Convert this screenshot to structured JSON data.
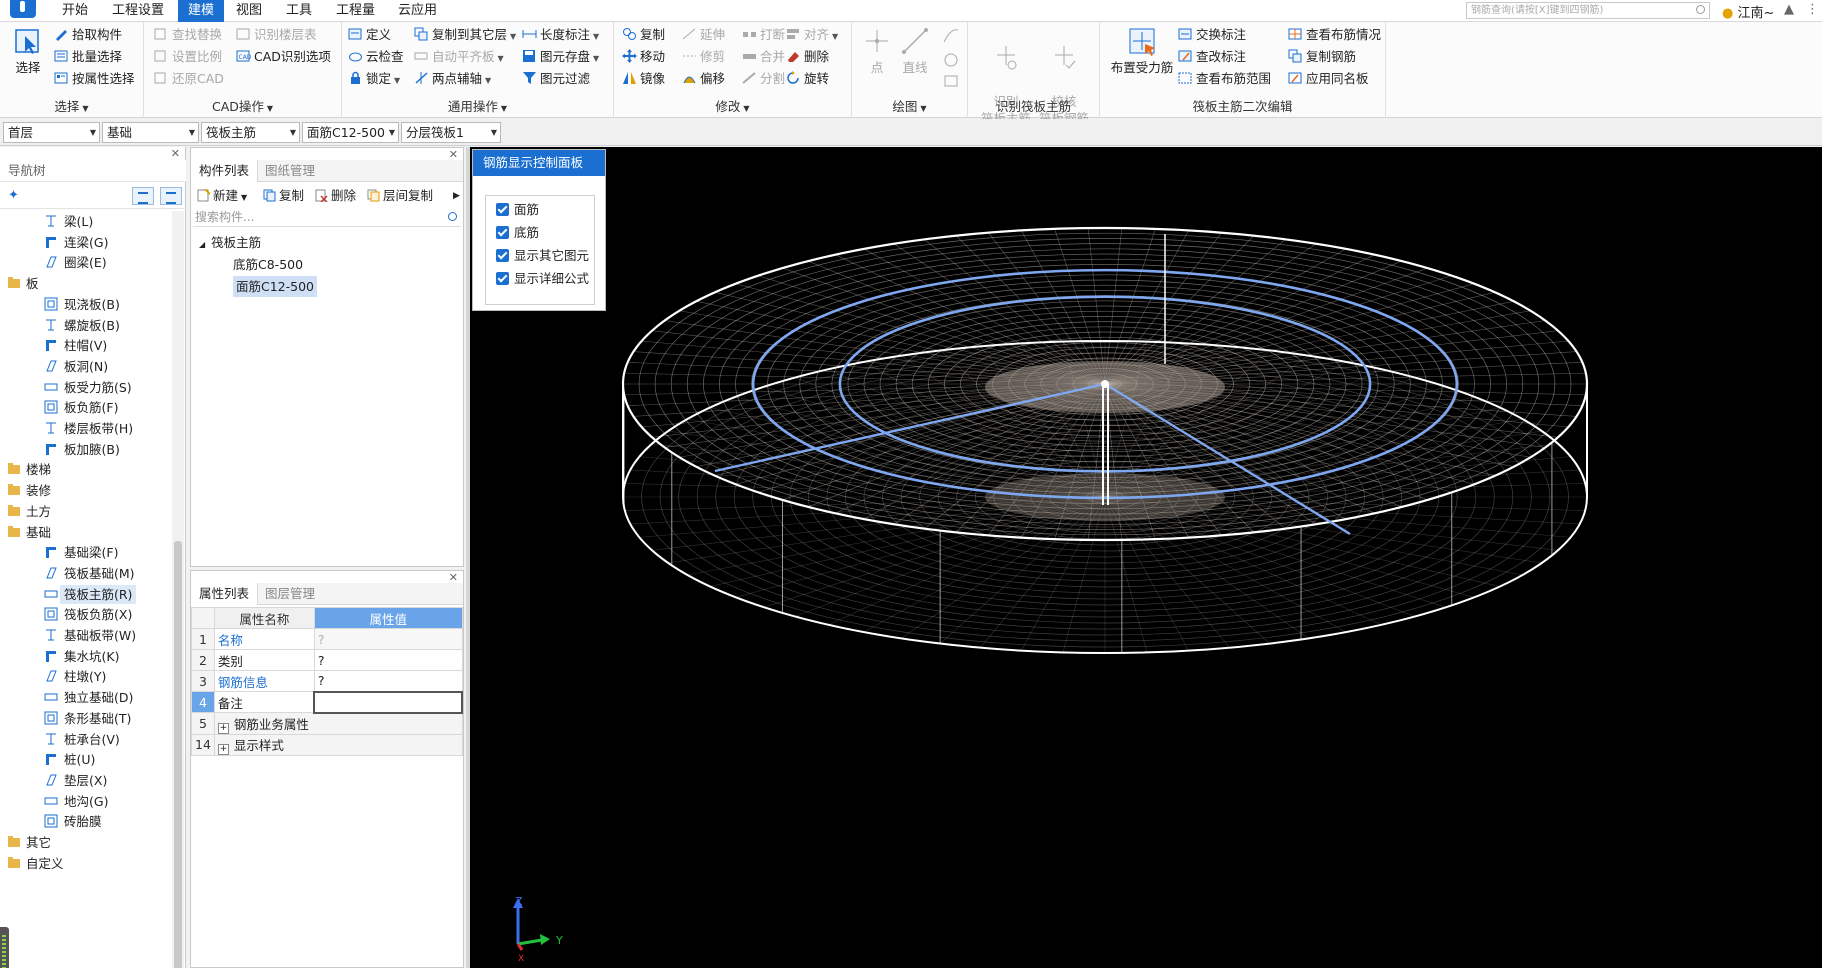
{
  "menubar": {
    "tabs": [
      "开始",
      "工程设置",
      "建模",
      "视图",
      "工具",
      "工程量",
      "云应用"
    ],
    "active_tab": "建模",
    "search_placeholder": "钢筋查询(请按[X]键到四钢筋)",
    "user": "江南~"
  },
  "ribbon": {
    "select_group": {
      "label": "选择",
      "big": "选择",
      "items": [
        "拾取构件",
        "批量选择",
        "按属性选择"
      ]
    },
    "cad_group": {
      "label": "CAD操作",
      "items": [
        "查找替换",
        "设置比例",
        "还原CAD",
        "识别楼层表",
        "CAD识别选项"
      ]
    },
    "general_group": {
      "label": "通用操作",
      "items": [
        "定义",
        "云检查",
        "锁定",
        "复制到其它层",
        "自动平齐板",
        "两点辅轴",
        "长度标注",
        "图元存盘",
        "图元过滤"
      ]
    },
    "modify_group": {
      "label": "修改",
      "items": [
        "复制",
        "移动",
        "镜像",
        "延伸",
        "修剪",
        "偏移",
        "打断",
        "合并",
        "分割",
        "对齐",
        "删除",
        "旋转"
      ]
    },
    "draw_group": {
      "label": "绘图",
      "items": [
        "点",
        "直线"
      ]
    },
    "identify_group": {
      "label": "识别筏板主筋",
      "items": [
        "识别\n筏板主筋",
        "校核\n筏板钢筋"
      ]
    },
    "edit_group": {
      "label": "筏板主筋二次编辑",
      "big": "布置受力筋",
      "items": [
        "交换标注",
        "查改标注",
        "查看布筋范围",
        "查看布筋情况",
        "复制钢筋",
        "应用同名板"
      ]
    }
  },
  "selectors": [
    "首层",
    "基础",
    "筏板主筋",
    "面筋C12-500",
    "分层筏板1"
  ],
  "nav": {
    "title": "导航树",
    "items": [
      {
        "type": "item",
        "label": "梁(L)",
        "icon": "beam-icon"
      },
      {
        "type": "item",
        "label": "连梁(G)",
        "icon": "coupling-beam-icon"
      },
      {
        "type": "item",
        "label": "圈梁(E)",
        "icon": "ring-beam-icon"
      },
      {
        "type": "cat",
        "label": "板"
      },
      {
        "type": "item",
        "label": "现浇板(B)",
        "icon": "slab-icon"
      },
      {
        "type": "item",
        "label": "螺旋板(B)",
        "icon": "spiral-slab-icon"
      },
      {
        "type": "item",
        "label": "柱帽(V)",
        "icon": "column-cap-icon"
      },
      {
        "type": "item",
        "label": "板洞(N)",
        "icon": "slab-hole-icon"
      },
      {
        "type": "item",
        "label": "板受力筋(S)",
        "icon": "slab-rebar-icon"
      },
      {
        "type": "item",
        "label": "板负筋(F)",
        "icon": "slab-neg-rebar-icon"
      },
      {
        "type": "item",
        "label": "楼层板带(H)",
        "icon": "slab-strip-icon"
      },
      {
        "type": "item",
        "label": "板加腋(B)",
        "icon": "slab-haunch-icon"
      },
      {
        "type": "cat",
        "label": "楼梯"
      },
      {
        "type": "cat",
        "label": "装修"
      },
      {
        "type": "cat",
        "label": "土方"
      },
      {
        "type": "cat",
        "label": "基础"
      },
      {
        "type": "item",
        "label": "基础梁(F)",
        "icon": "foundation-beam-icon"
      },
      {
        "type": "item",
        "label": "筏板基础(M)",
        "icon": "raft-foundation-icon"
      },
      {
        "type": "item",
        "label": "筏板主筋(R)",
        "icon": "raft-main-rebar-icon",
        "selected": true
      },
      {
        "type": "item",
        "label": "筏板负筋(X)",
        "icon": "raft-neg-rebar-icon"
      },
      {
        "type": "item",
        "label": "基础板带(W)",
        "icon": "foundation-strip-icon"
      },
      {
        "type": "item",
        "label": "集水坑(K)",
        "icon": "sump-icon"
      },
      {
        "type": "item",
        "label": "柱墩(Y)",
        "icon": "column-pier-icon"
      },
      {
        "type": "item",
        "label": "独立基础(D)",
        "icon": "isolated-footing-icon"
      },
      {
        "type": "item",
        "label": "条形基础(T)",
        "icon": "strip-footing-icon"
      },
      {
        "type": "item",
        "label": "桩承台(V)",
        "icon": "pile-cap-icon"
      },
      {
        "type": "item",
        "label": "桩(U)",
        "icon": "pile-icon"
      },
      {
        "type": "item",
        "label": "垫层(X)",
        "icon": "cushion-icon"
      },
      {
        "type": "item",
        "label": "地沟(G)",
        "icon": "trench-icon"
      },
      {
        "type": "item",
        "label": "砖胎膜",
        "icon": "brick-mold-icon"
      },
      {
        "type": "cat",
        "label": "其它"
      },
      {
        "type": "cat",
        "label": "自定义"
      }
    ]
  },
  "components": {
    "tabs": [
      "构件列表",
      "图纸管理"
    ],
    "toolbar": [
      "新建",
      "复制",
      "删除",
      "层间复制"
    ],
    "search_placeholder": "搜索构件...",
    "tree_root": "筏板主筋",
    "tree_items": [
      "底筋C8-500",
      "面筋C12-500"
    ],
    "selected": "面筋C12-500"
  },
  "properties": {
    "tabs": [
      "属性列表",
      "图层管理"
    ],
    "header_name": "属性名称",
    "header_value": "属性值",
    "rows": [
      {
        "num": "1",
        "name": "名称",
        "value": "?"
      },
      {
        "num": "2",
        "name": "类别",
        "value": "?"
      },
      {
        "num": "3",
        "name": "钢筋信息",
        "value": "?"
      },
      {
        "num": "4",
        "name": "备注",
        "value": ""
      },
      {
        "num": "5",
        "name": "钢筋业务属性",
        "value": ""
      },
      {
        "num": "14",
        "name": "显示样式",
        "value": ""
      }
    ]
  },
  "display_panel": {
    "title": "钢筋显示控制面板",
    "options": [
      "面筋",
      "底筋",
      "显示其它图元",
      "显示详细公式"
    ]
  },
  "axes": {
    "x": "X",
    "y": "Y",
    "z": "Z"
  },
  "colors": {
    "accent": "#1b6fd1",
    "rebar_highlight": "#7fa8f0",
    "mesh": "#e9dfd6"
  }
}
